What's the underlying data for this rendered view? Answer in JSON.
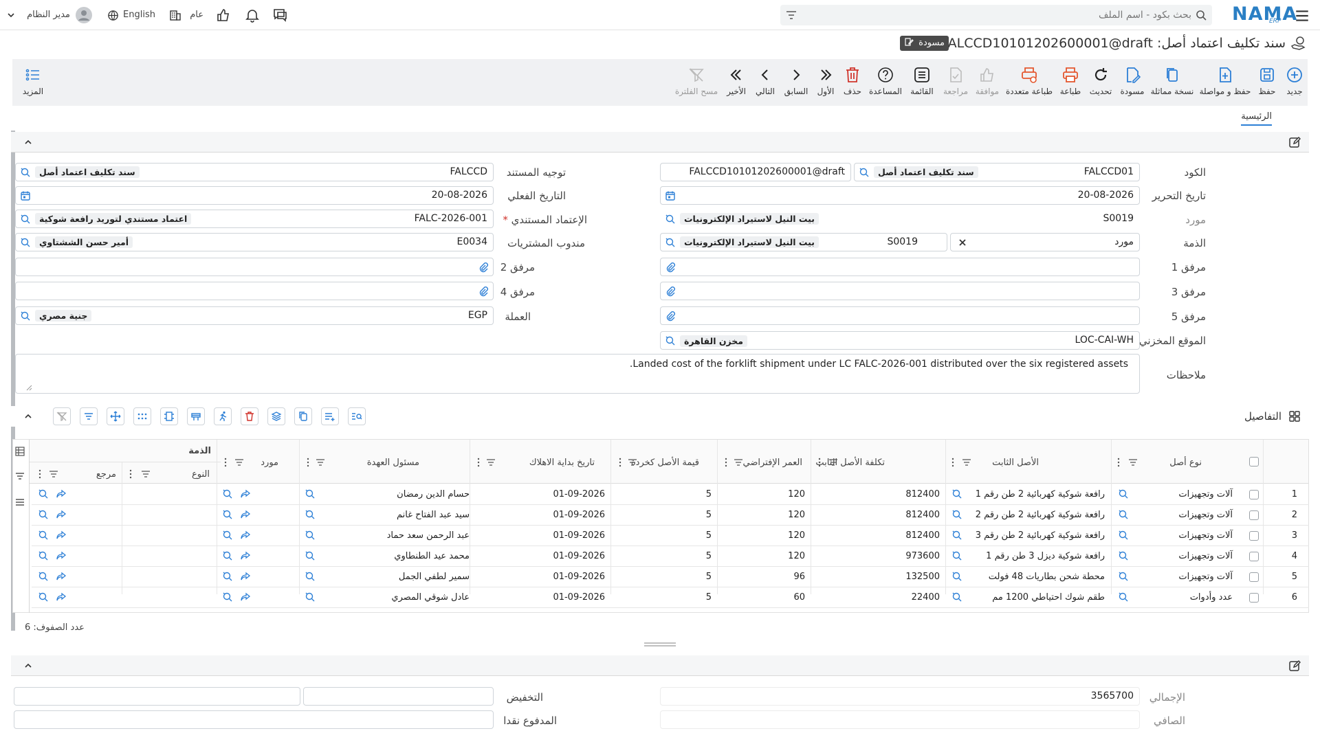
{
  "app": {
    "logo": "NAMA",
    "logo_sub": "ERP"
  },
  "topbar": {
    "search_placeholder": "بحث بكود - اسم الملف",
    "user": "مدير النظام",
    "language": "English",
    "company": "عام"
  },
  "title": {
    "text": "سند تكليف اعتماد أصل: FALCCD10101202600001@draft",
    "status": "مسودة"
  },
  "toolbar": {
    "new": "جديد",
    "save": "حفظ",
    "save_continue": "حفظ و مواصلة",
    "duplicate": "نسخة مماثلة",
    "draft": "مسودة",
    "refresh": "تحديث",
    "print": "طباعة",
    "multi_print": "طباعة متعددة",
    "approve": "موافقة",
    "review": "مراجعة",
    "list": "القائمة",
    "help": "المساعدة",
    "delete": "حذف",
    "first": "الأول",
    "previous": "السابق",
    "next": "التالي",
    "last": "الأخير",
    "clear_filter": "مسح الفلترة",
    "more": "المزيد"
  },
  "tabs": {
    "home": "الرئيسية"
  },
  "form": {
    "code_label": "الكود",
    "code_value": "FALCCD01",
    "code_name": "سند تكليف اعتماد أصل",
    "doc_number": "FALCCD10101202600001@draft",
    "doc_route_label": "توجيه المستند",
    "doc_route_value": "FALCCD",
    "doc_route_name": "سند تكليف اعتماد أصل",
    "edit_date_label": "تاريخ التحرير",
    "edit_date_value": "20-08-2026",
    "actual_date_label": "التاريخ الفعلي",
    "actual_date_value": "20-08-2026",
    "supplier_label": "مورد",
    "supplier_code": "S0019",
    "supplier_name": "بيت النيل لاستيراد الإلكترونيات",
    "lc_label": "الإعتماد المستندي",
    "lc_code": "FALC-2026-001",
    "lc_name": "اعتماد مستندي لتوريد رافعة شوكية",
    "account_label": "الذمة",
    "account_type": "مورد",
    "account_code": "S0019",
    "account_name": "بيت النيل لاستيراد الإلكترونيات",
    "purchase_rep_label": "مندوب المشتريات",
    "purchase_rep_code": "E0034",
    "purchase_rep_name": "أمير حسن الششتاوي",
    "att1_label": "مرفق 1",
    "att2_label": "مرفق 2",
    "att3_label": "مرفق 3",
    "att4_label": "مرفق 4",
    "att5_label": "مرفق 5",
    "currency_label": "العملة",
    "currency_code": "EGP",
    "currency_name": "جنية مصري",
    "location_label": "الموقع المخزني",
    "location_code": "LOC-CAI-WH",
    "location_name": "مخزن القاهرة",
    "notes_label": "ملاحظات",
    "notes_value": "Landed cost of the forklift shipment under LC FALC-2026-001 distributed over the six registered assets."
  },
  "details": {
    "title": "التفاصيل",
    "row_count": "عدد الصفوف: 6",
    "headers": {
      "asset_type": "نوع أصل",
      "fixed_asset": "الأصل الثابت",
      "asset_cost": "تكلفة الأصل الثابت",
      "default_life": "العمر الإفتراضي",
      "scrap_value": "قيمة الأصل كخردة",
      "depr_start": "تاريخ بداية الاهلاك",
      "custodian": "مسئول العهدة",
      "supplier": "مورد",
      "account_group": "الذمة",
      "type": "النوع",
      "reference": "مرجع"
    },
    "rows": [
      {
        "n": "1",
        "asset_type": "آلات وتجهيزات",
        "asset": "رافعة شوكية كهربائية 2 طن رقم 1",
        "cost": "812400",
        "life": "120",
        "scrap": "5",
        "date": "01-09-2026",
        "custodian": "حسام الدين رمضان"
      },
      {
        "n": "2",
        "asset_type": "آلات وتجهيزات",
        "asset": "رافعة شوكية كهربائية 2 طن رقم 2",
        "cost": "812400",
        "life": "120",
        "scrap": "5",
        "date": "01-09-2026",
        "custodian": "سيد عبد الفتاح غانم"
      },
      {
        "n": "3",
        "asset_type": "آلات وتجهيزات",
        "asset": "رافعة شوكية كهربائية 2 طن رقم 3",
        "cost": "812400",
        "life": "120",
        "scrap": "5",
        "date": "01-09-2026",
        "custodian": "عبد الرحمن سعد حماد"
      },
      {
        "n": "4",
        "asset_type": "آلات وتجهيزات",
        "asset": "رافعة شوكية ديزل 3 طن رقم 1",
        "cost": "973600",
        "life": "120",
        "scrap": "5",
        "date": "01-09-2026",
        "custodian": "محمد عيد الطنطاوي"
      },
      {
        "n": "5",
        "asset_type": "آلات وتجهيزات",
        "asset": "محطة شحن بطاريات 48 فولت",
        "cost": "132500",
        "life": "96",
        "scrap": "5",
        "date": "01-09-2026",
        "custodian": "سمير لطفي الجمل"
      },
      {
        "n": "6",
        "asset_type": "عدد وأدوات",
        "asset": "طقم شوك احتياطي 1200 مم",
        "cost": "22400",
        "life": "60",
        "scrap": "5",
        "date": "01-09-2026",
        "custodian": "عادل شوقي المصري"
      }
    ]
  },
  "totals": {
    "total_label": "الإجمالي",
    "total_value": "3565700",
    "discount_label": "التخفيض",
    "net_label": "الصافي",
    "cash_paid_label": "المدفوع نقدا"
  },
  "colors": {
    "accent": "#2c7fd6",
    "danger": "#d0342c",
    "toolbar_bg": "#f0f1f3"
  }
}
